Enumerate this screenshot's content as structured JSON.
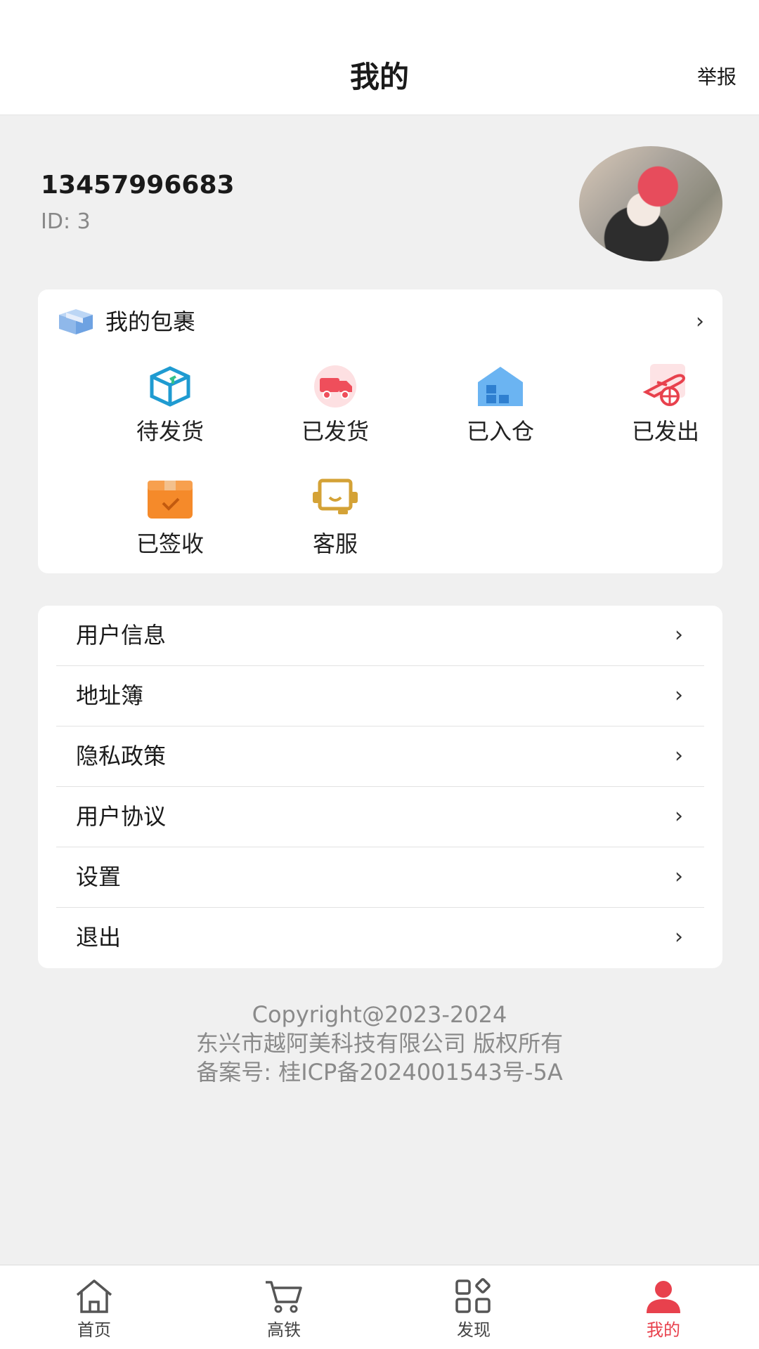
{
  "header": {
    "title": "我的",
    "action": "举报"
  },
  "profile": {
    "phone": "13457996683",
    "id_text": "ID: 3"
  },
  "packages": {
    "title": "我的包裹",
    "items": [
      {
        "label": "待发货",
        "icon": "parcel-pending-icon"
      },
      {
        "label": "已发货",
        "icon": "delivery-truck-icon"
      },
      {
        "label": "已入仓",
        "icon": "warehouse-icon"
      },
      {
        "label": "已发出",
        "icon": "airplane-globe-icon"
      },
      {
        "label": "已签收",
        "icon": "box-check-icon"
      },
      {
        "label": "客服",
        "icon": "customer-service-icon"
      }
    ]
  },
  "menu": {
    "items": [
      {
        "label": "用户信息"
      },
      {
        "label": "地址簿"
      },
      {
        "label": "隐私政策"
      },
      {
        "label": "用户协议"
      },
      {
        "label": "设置"
      },
      {
        "label": "退出"
      }
    ]
  },
  "footer": {
    "copyright": "Copyright@2023-2024",
    "company": "东兴市越阿美科技有限公司 版权所有",
    "icp": "备案号: 桂ICP备2024001543号-5A"
  },
  "tabbar": {
    "tabs": [
      {
        "label": "首页",
        "icon": "home-icon",
        "active": false
      },
      {
        "label": "高铁",
        "icon": "cart-icon",
        "active": false
      },
      {
        "label": "发现",
        "icon": "discover-grid-icon",
        "active": false
      },
      {
        "label": "我的",
        "icon": "user-icon",
        "active": true
      }
    ]
  },
  "colors": {
    "accent": "#e8414d",
    "background": "#f0f0f0",
    "card": "#ffffff",
    "muted_text": "#8a8a8a"
  }
}
